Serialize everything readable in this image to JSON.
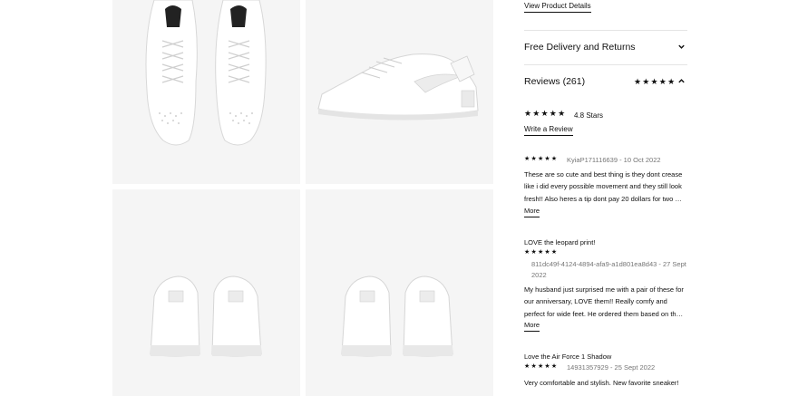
{
  "product_details_link": "View Product Details",
  "delivery": {
    "title": "Free Delivery and Returns"
  },
  "reviews": {
    "title": "Reviews (261)",
    "header_stars": "★★★★★",
    "summary_stars": "★★★★★",
    "rating_text": "4.8 Stars",
    "write_review": "Write a Review",
    "items": [
      {
        "title": "",
        "stars": "★★★★★",
        "meta": "KyiaP171116639 - 10 Oct 2022",
        "body": "These are so cute and best thing is they dont crease like i did every possible movement and they still look fresh!! Also heres a tip dont pay 20 dollars for two …",
        "more": "More"
      },
      {
        "title": "LOVE the leopard print!",
        "stars": "★★★★★",
        "meta": "811dc49f-4124-4894-afa9-a1d801ea8d43 - 27 Sept 2022",
        "body": "My husband just surprised me with a pair of these for our anniversary, LOVE them!! Really comfy and perfect for wide feet. He ordered them based on th…",
        "more": "More"
      },
      {
        "title": "Love the Air Force 1 Shadow",
        "stars": "★★★★★",
        "meta": "14931357929 - 25 Sept 2022",
        "body": "Very comfortable and stylish. New favorite sneaker!",
        "more": ""
      }
    ]
  },
  "icons": {
    "delivery_chevron": "chevron-down-icon",
    "reviews_chevron": "chevron-up-icon"
  },
  "colors": {
    "tile_bg": "#f5f5f5",
    "text": "#111111",
    "muted": "#757575",
    "divider": "#e5e5e5"
  }
}
